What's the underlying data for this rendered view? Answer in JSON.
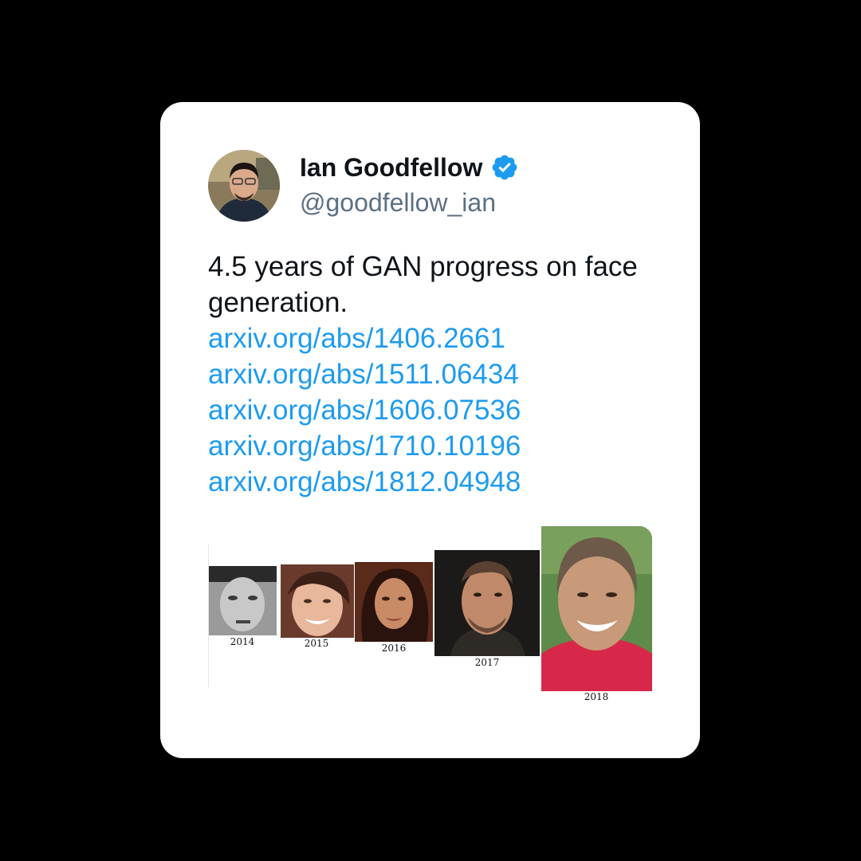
{
  "background_color": "#000000",
  "card_color": "#ffffff",
  "accent_color": "#1d9bf0",
  "author": {
    "display_name": "Ian Goodfellow",
    "handle": "@goodfellow_ian",
    "verified_icon": "verified-badge-icon",
    "avatar": "profile-photo"
  },
  "tweet": {
    "text_lines": [
      "4.5 years of GAN progress on face generation."
    ],
    "links": [
      "arxiv.org/abs/1406.2661",
      "arxiv.org/abs/1511.06434",
      "arxiv.org/abs/1606.07536",
      "arxiv.org/abs/1710.10196",
      "arxiv.org/abs/1812.04948"
    ]
  },
  "media": {
    "faces": [
      {
        "year": "2014"
      },
      {
        "year": "2015"
      },
      {
        "year": "2016"
      },
      {
        "year": "2017"
      },
      {
        "year": "2018"
      }
    ]
  }
}
